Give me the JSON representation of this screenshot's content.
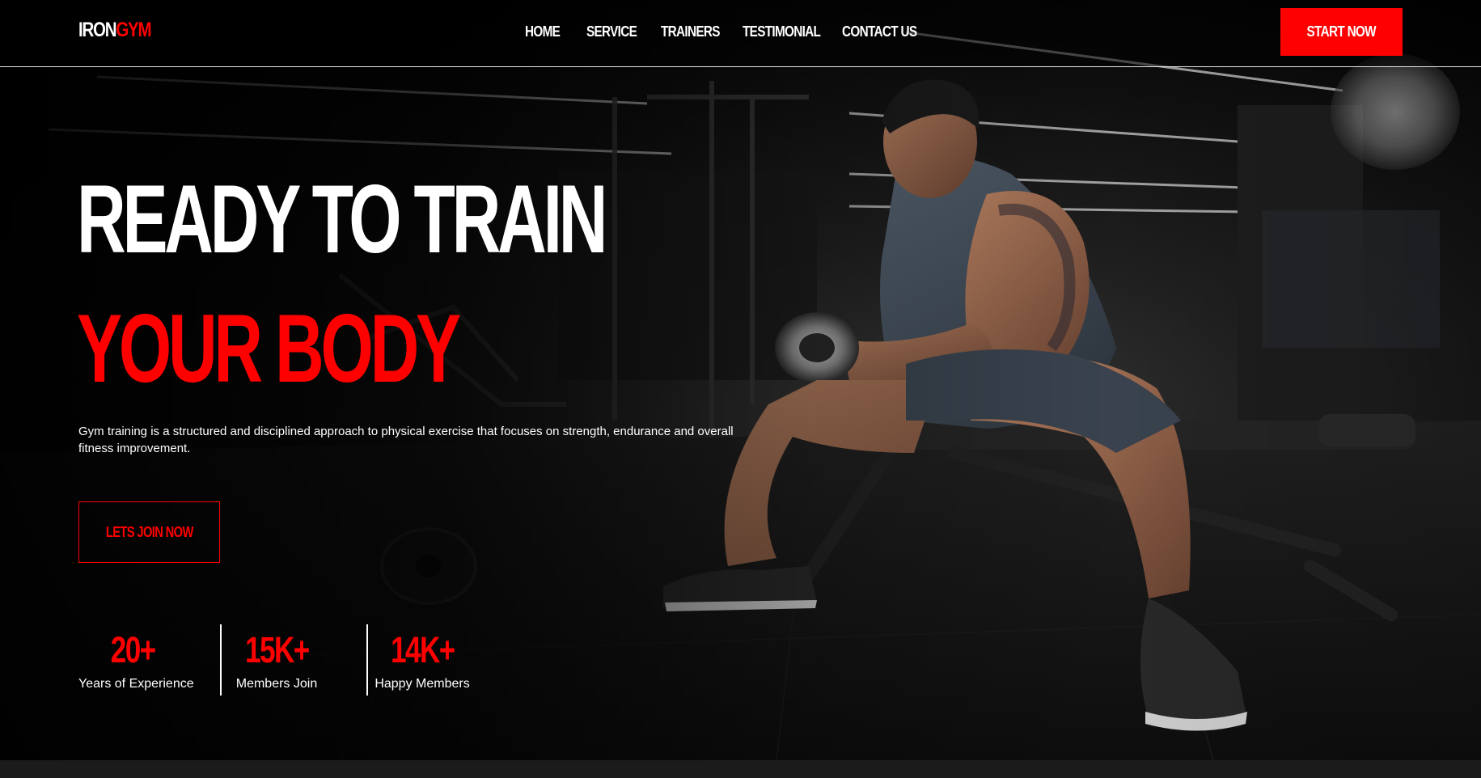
{
  "brand": {
    "logo_part1": "IRON",
    "logo_part2": "GYM",
    "accent_color": "#ff0000"
  },
  "nav": {
    "items": [
      {
        "label": "HOME"
      },
      {
        "label": "SERVICE"
      },
      {
        "label": "TRAINERS"
      },
      {
        "label": "TESTIMONIAL"
      },
      {
        "label": "CONTACT US"
      }
    ],
    "cta_label": "START NOW"
  },
  "hero": {
    "headline_line1": "READY TO TRAIN",
    "headline_line2": "YOUR BODY",
    "description": "Gym training is a structured and disciplined approach to physical exercise that focuses on strength, endurance and overall fitness improvement.",
    "join_label": "LETS JOIN NOW"
  },
  "stats": [
    {
      "value": "20+",
      "label": "Years of Experience"
    },
    {
      "value": "15K+",
      "label": "Members Join"
    },
    {
      "value": "14K+",
      "label": "Happy Members"
    }
  ]
}
